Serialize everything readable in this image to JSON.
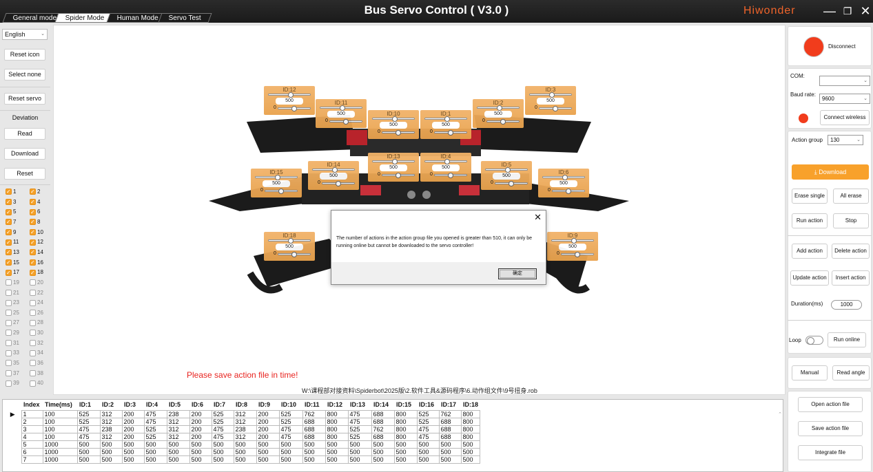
{
  "window": {
    "title": "Bus Servo Control ( V3.0 )",
    "brand": "Hiwonder",
    "mode_tabs": [
      {
        "label": "General mode",
        "active": false
      },
      {
        "label": "Spider Mode",
        "active": true
      },
      {
        "label": "Human Mode",
        "active": false
      },
      {
        "label": "Servo Test",
        "active": false
      }
    ],
    "controls": {
      "minimize": "—",
      "maximize": "❐",
      "close": "✕"
    }
  },
  "left_panel": {
    "language": "English",
    "reset_icon": "Reset icon",
    "select_none": "Select none",
    "reset_servo": "Reset servo",
    "deviation_label": "Deviation",
    "read": "Read",
    "download": "Download",
    "reset": "Reset",
    "servo_checks": [
      {
        "id": "1",
        "checked": true
      },
      {
        "id": "2",
        "checked": true
      },
      {
        "id": "3",
        "checked": true
      },
      {
        "id": "4",
        "checked": true
      },
      {
        "id": "5",
        "checked": true
      },
      {
        "id": "6",
        "checked": true
      },
      {
        "id": "7",
        "checked": true
      },
      {
        "id": "8",
        "checked": true
      },
      {
        "id": "9",
        "checked": true
      },
      {
        "id": "10",
        "checked": true
      },
      {
        "id": "11",
        "checked": true
      },
      {
        "id": "12",
        "checked": true
      },
      {
        "id": "13",
        "checked": true
      },
      {
        "id": "14",
        "checked": true
      },
      {
        "id": "15",
        "checked": true
      },
      {
        "id": "16",
        "checked": true
      },
      {
        "id": "17",
        "checked": true
      },
      {
        "id": "18",
        "checked": true
      },
      {
        "id": "19",
        "checked": false
      },
      {
        "id": "20",
        "checked": false
      },
      {
        "id": "21",
        "checked": false
      },
      {
        "id": "22",
        "checked": false
      },
      {
        "id": "23",
        "checked": false
      },
      {
        "id": "24",
        "checked": false
      },
      {
        "id": "25",
        "checked": false
      },
      {
        "id": "26",
        "checked": false
      },
      {
        "id": "27",
        "checked": false
      },
      {
        "id": "28",
        "checked": false
      },
      {
        "id": "29",
        "checked": false
      },
      {
        "id": "30",
        "checked": false
      },
      {
        "id": "31",
        "checked": false
      },
      {
        "id": "32",
        "checked": false
      },
      {
        "id": "33",
        "checked": false
      },
      {
        "id": "34",
        "checked": false
      },
      {
        "id": "35",
        "checked": false
      },
      {
        "id": "36",
        "checked": false
      },
      {
        "id": "37",
        "checked": false
      },
      {
        "id": "38",
        "checked": false
      },
      {
        "id": "39",
        "checked": false
      },
      {
        "id": "40",
        "checked": false
      }
    ]
  },
  "canvas": {
    "servos": [
      {
        "label": "ID:12",
        "value": "500",
        "zero": "0"
      },
      {
        "label": "ID:11",
        "value": "500",
        "zero": "0"
      },
      {
        "label": "ID:10",
        "value": "500",
        "zero": "0"
      },
      {
        "label": "ID:1",
        "value": "500",
        "zero": "0"
      },
      {
        "label": "ID:2",
        "value": "500",
        "zero": "0"
      },
      {
        "label": "ID:3",
        "value": "500",
        "zero": "0"
      },
      {
        "label": "ID:15",
        "value": "500",
        "zero": "0"
      },
      {
        "label": "ID:14",
        "value": "500",
        "zero": "0"
      },
      {
        "label": "ID:13",
        "value": "500",
        "zero": "0"
      },
      {
        "label": "ID:4",
        "value": "500",
        "zero": "0"
      },
      {
        "label": "ID:5",
        "value": "500",
        "zero": "0"
      },
      {
        "label": "ID:6",
        "value": "500",
        "zero": "0"
      },
      {
        "label": "ID:18",
        "value": "500",
        "zero": "0"
      },
      {
        "label": "ID:9",
        "value": "500",
        "zero": "0"
      }
    ],
    "warning": "Please save action file in time!",
    "file_path": "W:\\课程部对接资料\\Spiderbot\\2025版\\2.软件工具&源码程序\\6.动作组文件\\9号扭身.rob"
  },
  "dialog": {
    "message": "The number of actions in the action group file you opened is greater than 510, it can only be running online but cannot be downloaded to the servo controller!",
    "ok": "确定",
    "close": "✕"
  },
  "right_panel": {
    "disconnect": "Disconnect",
    "com_label": "COM:",
    "com_value": "",
    "baud_label": "Baud rate:",
    "baud_value": "9600",
    "connect_wireless": "Connect wireless",
    "action_group_label": "Action group",
    "action_group_value": "130",
    "download": "Download",
    "erase_single": "Erase single",
    "all_erase": "All erase",
    "run_action": "Run action",
    "stop": "Stop",
    "add_action": "Add action",
    "delete_action": "Delete action",
    "update_action": "Update action",
    "insert_action": "Insert action",
    "duration_label": "Duration(ms)",
    "duration_value": "1000",
    "loop_label": "Loop",
    "run_online": "Run online",
    "manual": "Manual",
    "read_angle": "Read angle",
    "open_action_file": "Open action file",
    "save_action_file": "Save action file",
    "integrate_file": "Integrate file",
    "status_color": "#f13c1c"
  },
  "table": {
    "columns": [
      "Index",
      "Time(ms)",
      "ID:1",
      "ID:2",
      "ID:3",
      "ID:4",
      "ID:5",
      "ID:6",
      "ID:7",
      "ID:8",
      "ID:9",
      "ID:10",
      "ID:11",
      "ID:12",
      "ID:13",
      "ID:14",
      "ID:15",
      "ID:16",
      "ID:17",
      "ID:18"
    ],
    "rows": [
      [
        "1",
        "100",
        "525",
        "312",
        "200",
        "475",
        "238",
        "200",
        "525",
        "312",
        "200",
        "525",
        "762",
        "800",
        "475",
        "688",
        "800",
        "525",
        "762",
        "800"
      ],
      [
        "2",
        "100",
        "525",
        "312",
        "200",
        "475",
        "312",
        "200",
        "525",
        "312",
        "200",
        "525",
        "688",
        "800",
        "475",
        "688",
        "800",
        "525",
        "688",
        "800"
      ],
      [
        "3",
        "100",
        "475",
        "238",
        "200",
        "525",
        "312",
        "200",
        "475",
        "238",
        "200",
        "475",
        "688",
        "800",
        "525",
        "762",
        "800",
        "475",
        "688",
        "800"
      ],
      [
        "4",
        "100",
        "475",
        "312",
        "200",
        "525",
        "312",
        "200",
        "475",
        "312",
        "200",
        "475",
        "688",
        "800",
        "525",
        "688",
        "800",
        "475",
        "688",
        "800"
      ],
      [
        "5",
        "1000",
        "500",
        "500",
        "500",
        "500",
        "500",
        "500",
        "500",
        "500",
        "500",
        "500",
        "500",
        "500",
        "500",
        "500",
        "500",
        "500",
        "500",
        "500"
      ],
      [
        "6",
        "1000",
        "500",
        "500",
        "500",
        "500",
        "500",
        "500",
        "500",
        "500",
        "500",
        "500",
        "500",
        "500",
        "500",
        "500",
        "500",
        "500",
        "500",
        "500"
      ],
      [
        "7",
        "1000",
        "500",
        "500",
        "500",
        "500",
        "500",
        "500",
        "500",
        "500",
        "500",
        "500",
        "500",
        "500",
        "500",
        "500",
        "500",
        "500",
        "500",
        "500"
      ]
    ],
    "selected_row": 0
  }
}
